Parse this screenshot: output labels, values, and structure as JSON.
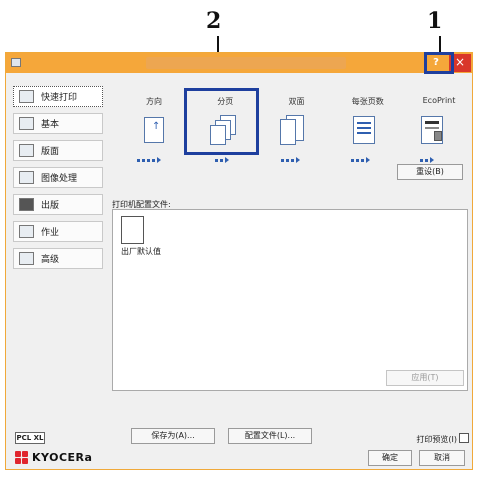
{
  "callouts": {
    "left": "2",
    "right": "1"
  },
  "window": {
    "help_label": "?",
    "close_label": "×"
  },
  "sidebar": {
    "items": [
      {
        "label": "快速打印"
      },
      {
        "label": "基本"
      },
      {
        "label": "版面"
      },
      {
        "label": "图像处理"
      },
      {
        "label": "出版"
      },
      {
        "label": "作业"
      },
      {
        "label": "高级"
      }
    ]
  },
  "quick_print": {
    "tabs": [
      "方向",
      "分页",
      "双面",
      "每张页数",
      "EcoPrint"
    ],
    "reset_button": "重设(B)"
  },
  "profiles": {
    "label": "打印机配置文件:",
    "items": [
      {
        "name": "出厂默认值"
      }
    ],
    "apply_button": "应用(T)"
  },
  "footer": {
    "save_as_button": "保存为(A)...",
    "profile_button": "配置文件(L)...",
    "pdl_badge": "PCL XL",
    "preview_label": "打印预览(I)",
    "ok_button": "确定",
    "cancel_button": "取消",
    "brand": "KYOCERa"
  },
  "colors": {
    "titlebar": "#f5a73a",
    "close": "#d9362b",
    "highlight": "#1e3f9e",
    "brand": "#e0262e"
  }
}
